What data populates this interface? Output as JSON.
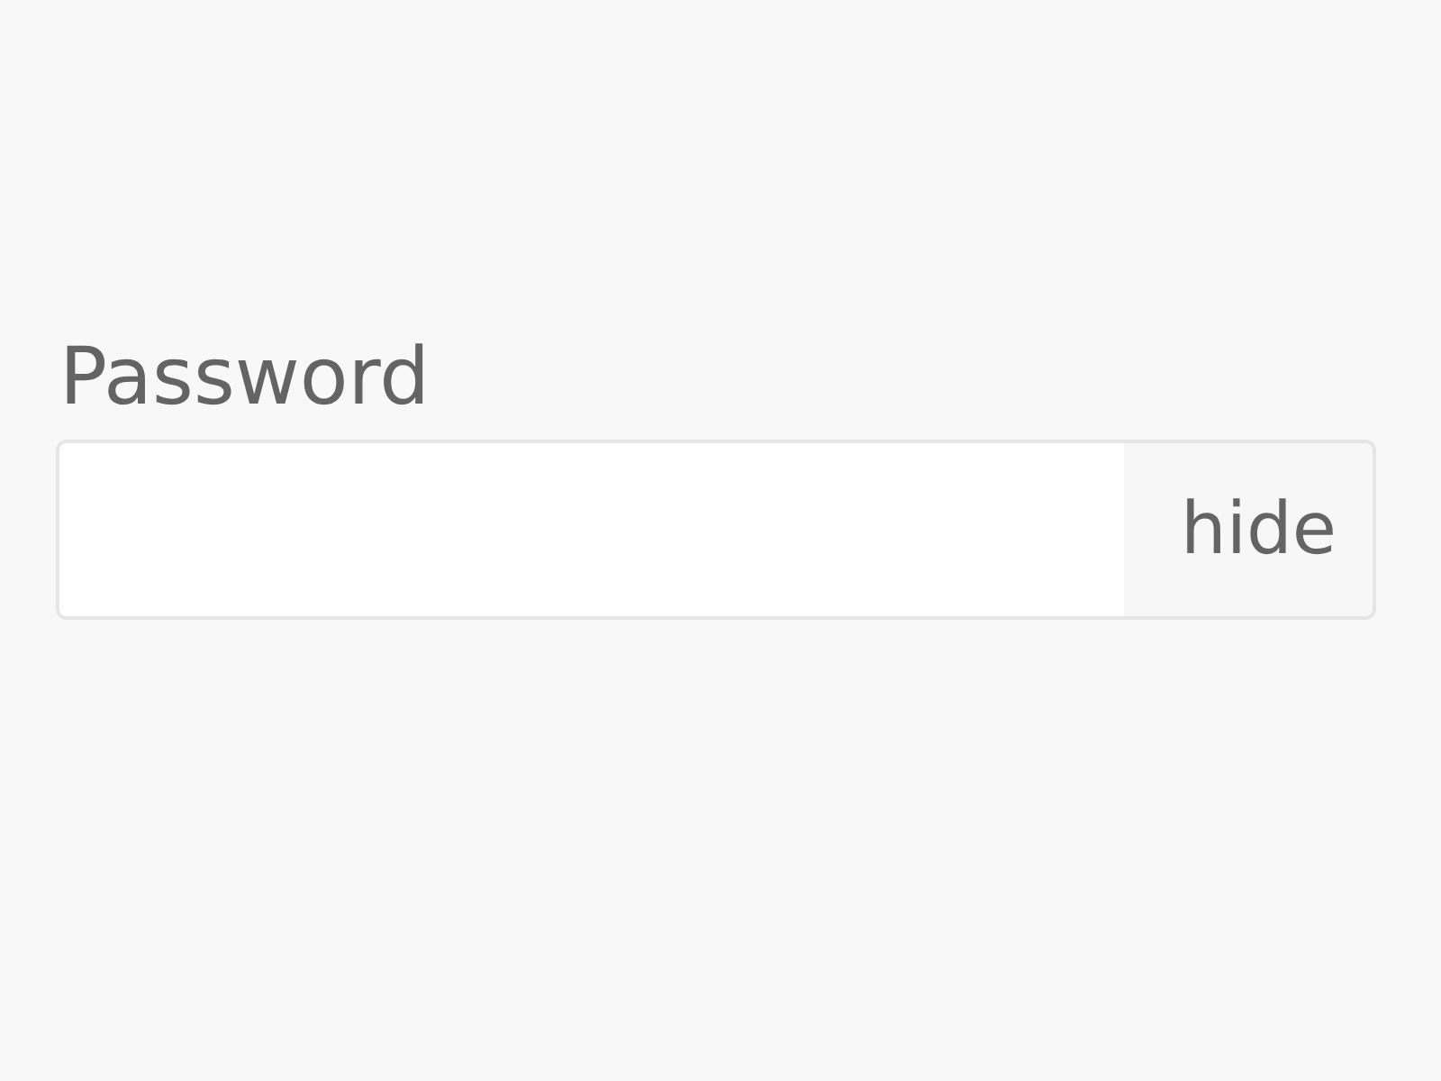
{
  "password_field": {
    "label": "Password",
    "toggle": "hide"
  }
}
